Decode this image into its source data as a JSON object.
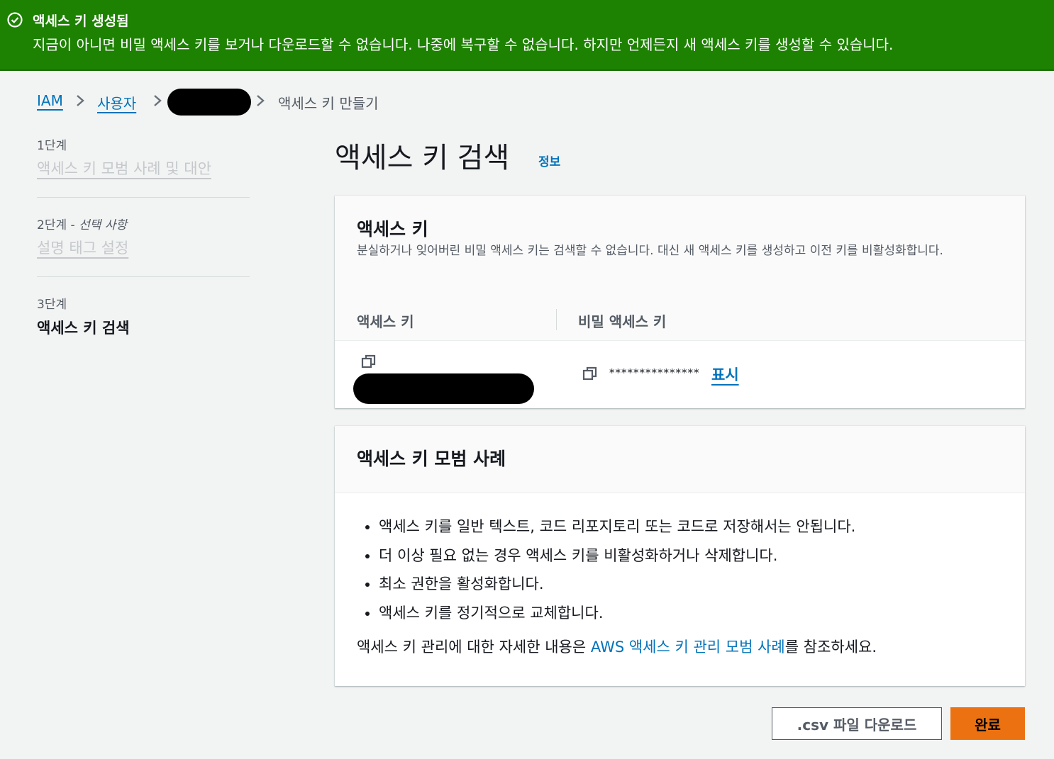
{
  "flash": {
    "title": "액세스 키 생성됨",
    "message": "지금이 아니면 비밀 액세스 키를 보거나 다운로드할 수 없습니다. 나중에 복구할 수 없습니다. 하지만 언제든지 새 액세스 키를 생성할 수 있습니다.",
    "icon": "check-circle-icon"
  },
  "breadcrumb": {
    "items": [
      "IAM",
      "사용자",
      "액세스 키 만들기"
    ]
  },
  "steps": [
    {
      "number": "1단계",
      "label": "액세스 키 모범 사례 및 대안"
    },
    {
      "number": "2단계",
      "optional": "선택 사항",
      "label": "설명 태그 설정"
    },
    {
      "number": "3단계",
      "label": "액세스 키 검색"
    }
  ],
  "page": {
    "title": "액세스 키 검색",
    "info_link": "정보"
  },
  "keys_card": {
    "title": "액세스 키",
    "description": "분실하거나 잊어버린 비밀 액세스 키는 검색할 수 없습니다. 대신 새 액세스 키를 생성하고 이전 키를 비활성화합니다.",
    "col_access_key": "액세스 키",
    "col_secret_key": "비밀 액세스 키",
    "secret_masked": "***************",
    "show_label": "표시"
  },
  "best_practices": {
    "title": "액세스 키 모범 사례",
    "items": [
      "액세스 키를 일반 텍스트, 코드 리포지토리 또는 코드로 저장해서는 안됩니다.",
      "더 이상 필요 없는 경우 액세스 키를 비활성화하거나 삭제합니다.",
      "최소 권한을 활성화합니다.",
      "액세스 키를 정기적으로 교체합니다."
    ],
    "ref_prefix": "액세스 키 관리에 대한 자세한 내용은 ",
    "ref_link": "AWS 액세스 키 관리 모범 사례",
    "ref_suffix": "를 참조하세요."
  },
  "actions": {
    "download_csv": ".csv 파일 다운로드",
    "done": "완료"
  },
  "colors": {
    "success": "#1d8102",
    "link": "#0073bb",
    "primary": "#ec7211"
  }
}
